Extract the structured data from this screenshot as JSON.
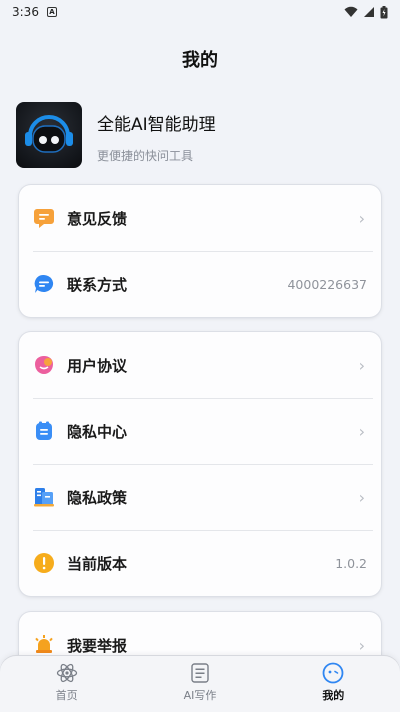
{
  "status_bar": {
    "time": "3:36",
    "notification_badge": "A"
  },
  "page_title": "我的",
  "profile": {
    "app_name": "全能AI智能助理",
    "subtitle": "更便捷的快问工具"
  },
  "card1": [
    {
      "label": "意见反馈",
      "value": "",
      "icon": "feedback-icon",
      "color": "#f6a13a"
    },
    {
      "label": "联系方式",
      "value": "4000226637",
      "icon": "contact-icon",
      "color": "#2f86f2"
    }
  ],
  "card2": [
    {
      "label": "用户协议",
      "value": "",
      "icon": "agreement-icon",
      "color": "#ec5f9e"
    },
    {
      "label": "隐私中心",
      "value": "",
      "icon": "privacy-center-icon",
      "color": "#3a8ef6"
    },
    {
      "label": "隐私政策",
      "value": "",
      "icon": "privacy-policy-icon",
      "color": "#2d7fea"
    },
    {
      "label": "当前版本",
      "value": "1.0.2",
      "icon": "version-icon",
      "color": "#f6ac1c"
    }
  ],
  "card3": [
    {
      "label": "我要举报",
      "value": "",
      "icon": "report-icon",
      "color": "#f5a21f"
    }
  ],
  "bottom_nav": [
    {
      "label": "首页",
      "icon": "atom-icon"
    },
    {
      "label": "AI写作",
      "icon": "writing-icon"
    },
    {
      "label": "我的",
      "icon": "profile-face-icon"
    }
  ],
  "colors": {
    "accent": "#2f86f2",
    "background": "#f1f3f8"
  }
}
